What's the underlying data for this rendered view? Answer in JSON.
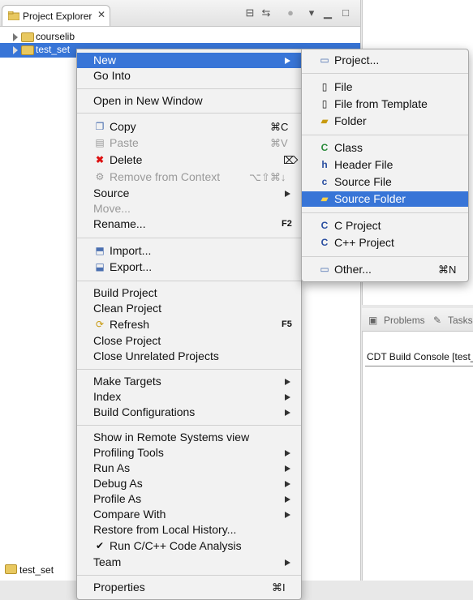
{
  "explorer": {
    "tab_label": "Project Explorer",
    "tree": [
      "courselib",
      "test_set"
    ]
  },
  "status_bar": {
    "label": "test_set"
  },
  "right_panel": {
    "tabs": [
      "Problems",
      "Tasks"
    ],
    "console_title": "CDT Build Console [test_set]"
  },
  "context_menu": {
    "new": "New",
    "go_into": "Go Into",
    "open_in_new_window": "Open in New Window",
    "copy": "Copy",
    "copy_sc": "⌘C",
    "paste": "Paste",
    "paste_sc": "⌘V",
    "delete": "Delete",
    "delete_sc": "⌦",
    "remove_from_context": "Remove from Context",
    "remove_sc": "⌥⇧⌘↓",
    "source": "Source",
    "move": "Move...",
    "rename": "Rename...",
    "rename_sc": "F2",
    "import": "Import...",
    "export": "Export...",
    "build_project": "Build Project",
    "clean_project": "Clean Project",
    "refresh": "Refresh",
    "refresh_sc": "F5",
    "close_project": "Close Project",
    "close_unrelated": "Close Unrelated Projects",
    "make_targets": "Make Targets",
    "index": "Index",
    "build_configurations": "Build Configurations",
    "show_remote": "Show in Remote Systems view",
    "profiling_tools": "Profiling Tools",
    "run_as": "Run As",
    "debug_as": "Debug As",
    "profile_as": "Profile As",
    "compare_with": "Compare With",
    "restore_history": "Restore from Local History...",
    "run_analysis": "Run C/C++ Code Analysis",
    "team": "Team",
    "properties": "Properties",
    "properties_sc": "⌘I"
  },
  "new_submenu": {
    "project": "Project...",
    "file": "File",
    "file_from_template": "File from Template",
    "folder": "Folder",
    "class": "Class",
    "header_file": "Header File",
    "source_file": "Source File",
    "source_folder": "Source Folder",
    "c_project": "C Project",
    "cpp_project": "C++ Project",
    "other": "Other...",
    "other_sc": "⌘N"
  },
  "colors": {
    "selection": "#3875d7",
    "menu_bg": "#f2f2f2"
  }
}
